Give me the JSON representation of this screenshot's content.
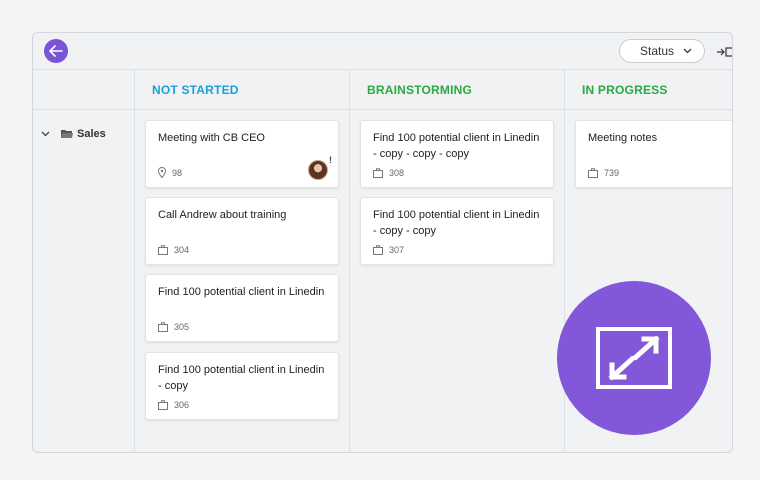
{
  "toolbar": {
    "status_select": "Status",
    "colors": {
      "accent": "#7b53d6"
    }
  },
  "groups": [
    {
      "label": "Sales",
      "icon": "folder-icon",
      "expanded": true
    }
  ],
  "columns": [
    {
      "title": "NOT STARTED",
      "color": "#1d9fd6",
      "cards": [
        {
          "title": "Meeting with CB CEO",
          "id": "98",
          "meta_icon": "location-pin-icon",
          "has_avatar": true,
          "badge": "!"
        },
        {
          "title": "Call Andrew about training",
          "id": "304",
          "meta_icon": "briefcase-icon"
        },
        {
          "title": "Find 100 potential client in Linedin",
          "id": "305",
          "meta_icon": "briefcase-icon"
        },
        {
          "title": "Find 100 potential client in Linedin - copy",
          "id": "306",
          "meta_icon": "briefcase-icon"
        }
      ]
    },
    {
      "title": "BRAINSTORMING",
      "color": "#2aa843",
      "cards": [
        {
          "title": "Find 100 potential client in Linedin - copy - copy - copy",
          "id": "308",
          "meta_icon": "briefcase-icon"
        },
        {
          "title": "Find 100 potential client in Linedin - copy - copy",
          "id": "307",
          "meta_icon": "briefcase-icon"
        }
      ]
    },
    {
      "title": "IN PROGRESS",
      "color": "#2aa843",
      "cards": [
        {
          "title": "Meeting notes",
          "id": "739",
          "meta_icon": "briefcase-icon"
        }
      ]
    }
  ],
  "overlay": {
    "icon": "fullscreen-icon",
    "color": "#8257d9"
  }
}
